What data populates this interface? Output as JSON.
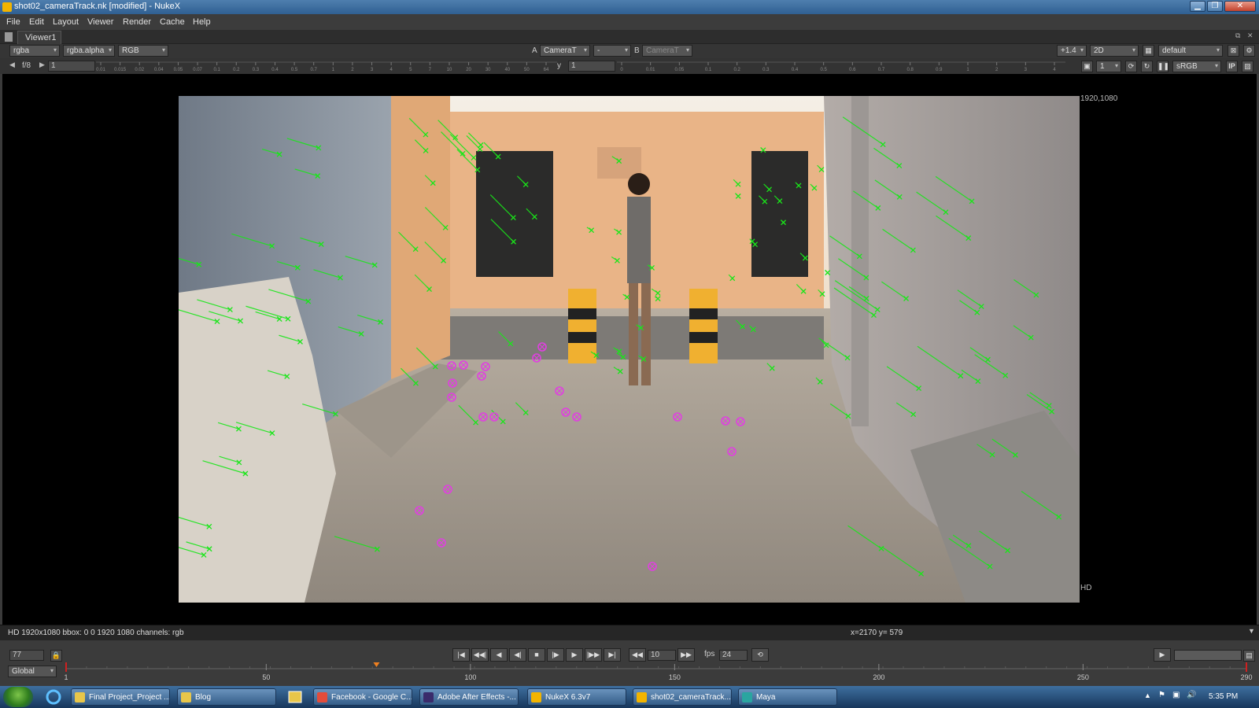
{
  "window": {
    "title": "shot02_cameraTrack.nk [modified] - NukeX",
    "controls": {
      "minimize": "▁",
      "restore": "❐",
      "close": "✕"
    }
  },
  "menubar": [
    "File",
    "Edit",
    "Layout",
    "Viewer",
    "Render",
    "Cache",
    "Help"
  ],
  "tabs": {
    "active": "Viewer1"
  },
  "viewer_toolbar": {
    "channels": "rgba",
    "alpha": "rgba.alpha",
    "display": "RGB",
    "input_a_label": "A",
    "input_a": "CameraT",
    "blend": "-",
    "input_b_label": "B",
    "input_b": "CameraT",
    "zoom": "+1.4",
    "view_mode": "2D",
    "lut_preset": "default",
    "fstop": "f/8",
    "gain": "1",
    "y_label": "y",
    "gamma": "1",
    "proxy": "1",
    "colorspace": "sRGB",
    "ip_label": "IP",
    "gain_ticks": [
      "0.01",
      "0.015",
      "0.02",
      "0.04",
      "0.05",
      "0.07",
      "0.1",
      "0.2",
      "0.3",
      "0.4",
      "0.5",
      "0.7",
      "1",
      "2",
      "3",
      "4",
      "5",
      "7",
      "10",
      "20",
      "30",
      "40",
      "50",
      "64"
    ],
    "gamma_ticks": [
      "0",
      "0.01",
      "0.05",
      "0.1",
      "0.2",
      "0.3",
      "0.4",
      "0.5",
      "0.6",
      "0.7",
      "0.8",
      "0.9",
      "1",
      "2",
      "3",
      "4"
    ]
  },
  "viewer": {
    "format_label_top": "1920,1080",
    "format_label_bottom": "HD"
  },
  "infobar": {
    "left": "HD 1920x1080 bbox: 0 0 1920 1080 channels: rgb",
    "right": "x=2170 y= 579"
  },
  "playback": {
    "current_frame": "77",
    "increment": "10",
    "fps_label": "fps",
    "fps": "24",
    "range_mode": "Global",
    "frame_marker": "77",
    "timeline_labels": [
      "1",
      "50",
      "100",
      "150",
      "200",
      "250",
      "290"
    ],
    "end_marker": "290",
    "buttons": [
      "|◀",
      "◀◀|",
      "◀",
      "◀|",
      "■",
      "|▶",
      "▶",
      "|▶▶",
      "▶|",
      "◀◀",
      "▶▶"
    ]
  },
  "taskbar": {
    "items": [
      {
        "label": "Final Project_Project ...",
        "icon_color": "#e8c64a"
      },
      {
        "label": "Blog",
        "icon_color": "#e8c64a"
      },
      {
        "label": "Facebook - Google C...",
        "icon_color": "#e34c3b"
      },
      {
        "label": "Adobe After Effects -...",
        "icon_color": "#3a2b6b"
      },
      {
        "label": "NukeX 6.3v7",
        "icon_color": "#f2b400"
      },
      {
        "label": "shot02_cameraTrack....",
        "icon_color": "#f2b400"
      },
      {
        "label": "Maya",
        "icon_color": "#2aa5a0"
      }
    ],
    "clock": "5:35 PM"
  },
  "tracks": {
    "marker_color": "#19e619",
    "selected_color": "#e040e0"
  }
}
